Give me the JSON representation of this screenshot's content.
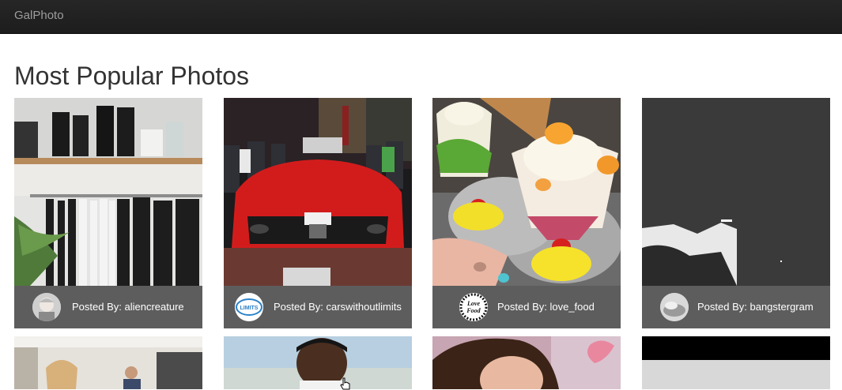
{
  "navbar": {
    "brand": "GalPhoto"
  },
  "page": {
    "title": "Most Popular Photos"
  },
  "photos": [
    {
      "posted_prefix": "Posted By:",
      "username": "aliencreature",
      "label": "Posted By: aliencreature",
      "subject": "clothing-rack-boots-shelf"
    },
    {
      "posted_prefix": "Posted By:",
      "username": "carswithoutlimits",
      "label": "Posted By: carswithoutlimits",
      "subject": "red-sports-car-rear",
      "avatar_text": "LIMITS"
    },
    {
      "posted_prefix": "Posted By:",
      "username": "love_food",
      "label": "Posted By: love_food",
      "subject": "ice-cream-sundaes",
      "avatar_text_1": "Love",
      "avatar_text_2": "Food"
    },
    {
      "posted_prefix": "Posted By:",
      "username": "bangstergram",
      "label": "Posted By: bangstergram",
      "subject": "dark-grey-landscape"
    }
  ],
  "photos_row2": [
    {
      "subject": "people-in-room"
    },
    {
      "subject": "man-portrait"
    },
    {
      "subject": "woman-portrait"
    },
    {
      "subject": "black-grey-blocks"
    }
  ],
  "colors": {
    "navbar_bg": "#222222",
    "brand_text": "#9d9d9d",
    "caption_bg": "#5d5d5d",
    "title_text": "#333333"
  }
}
